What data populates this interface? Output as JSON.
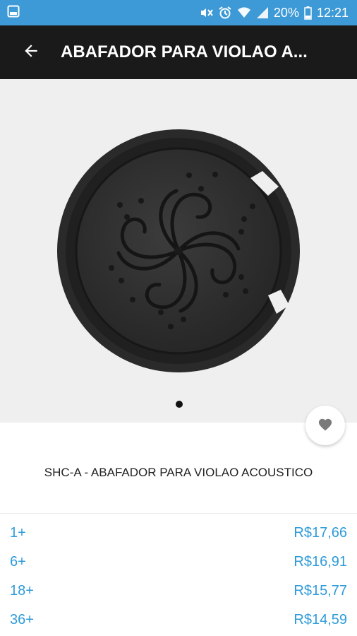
{
  "status_bar": {
    "battery": "20%",
    "time": "12:21",
    "color": "#3d9ad6"
  },
  "app_bar": {
    "title": "ABAFADOR PARA VIOLAO A...",
    "back_icon": "arrow-left-icon"
  },
  "product": {
    "image": "soundhole-cover-image",
    "pager": {
      "count": 1,
      "active": 0
    },
    "favorite_icon": "heart-icon",
    "name": "SHC-A - ABAFADOR PARA VIOLAO ACOUSTICO"
  },
  "prices": [
    {
      "qty": "1+",
      "price": "R$17,66"
    },
    {
      "qty": "6+",
      "price": "R$16,91"
    },
    {
      "qty": "18+",
      "price": "R$15,77"
    },
    {
      "qty": "36+",
      "price": "R$14,59"
    }
  ],
  "colors": {
    "accent": "#2e9bd9",
    "app_bar": "#1a1a1a"
  }
}
